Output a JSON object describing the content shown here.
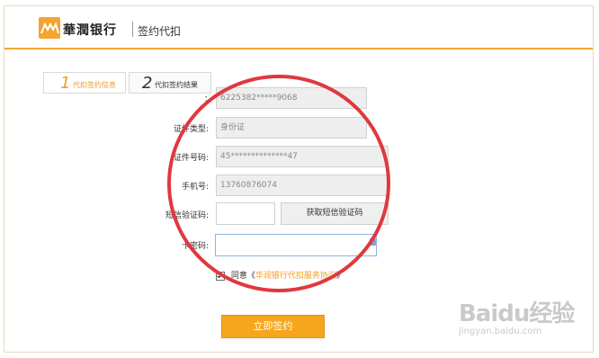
{
  "header": {
    "bank_name": "華潤银行",
    "subtitle": "签约代扣"
  },
  "steps": [
    {
      "number": "1",
      "label": "代扣签约信息"
    },
    {
      "number": "2",
      "label": "代扣签约结果"
    }
  ],
  "form": {
    "card_number": {
      "label": "：",
      "value": "6225382*****9068"
    },
    "id_type": {
      "label": "证件类型:",
      "value": "身份证"
    },
    "id_number": {
      "label": "证件号码:",
      "value": "45**************47"
    },
    "phone": {
      "label": "手机号:",
      "value": "13760876074"
    },
    "sms_code": {
      "label": "短信验证码:",
      "value": "",
      "button": "获取短信验证码"
    },
    "card_password": {
      "label": "卡密码:",
      "value": ""
    },
    "agreement": {
      "prefix": "同意《",
      "link": "华润银行代扣服务协议",
      "suffix": "》",
      "checked": true
    }
  },
  "submit_label": "立即签约",
  "watermark": {
    "top": "Baidu经验",
    "bottom": "jingyan.baidu.com"
  },
  "colors": {
    "accent": "#f29a1f",
    "highlight_circle": "#e0383f"
  }
}
